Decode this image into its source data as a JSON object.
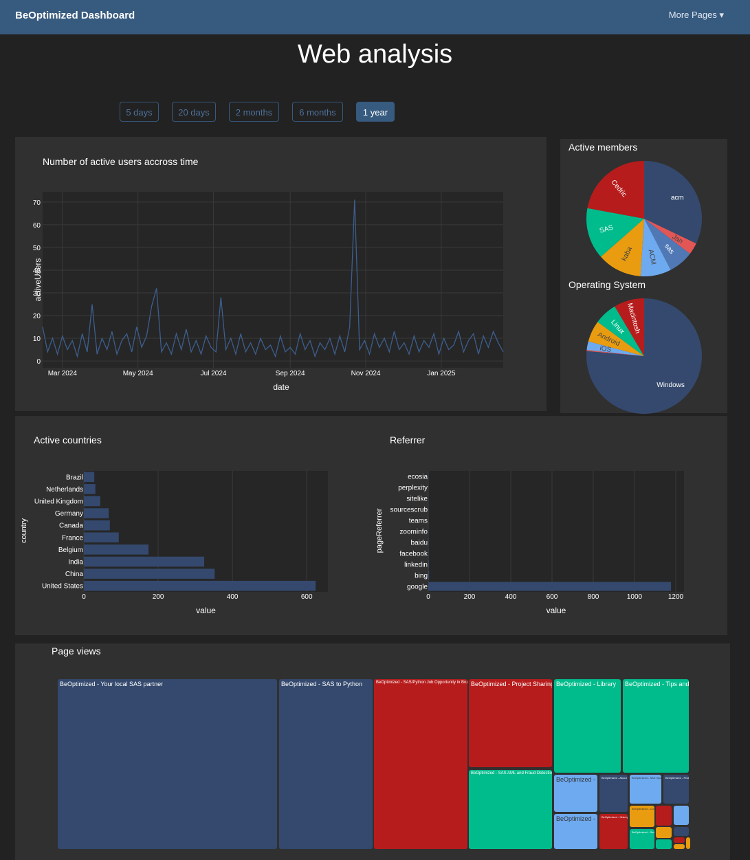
{
  "nav": {
    "brand": "BeOptimized Dashboard",
    "more": "More Pages ▾"
  },
  "title": "Web analysis",
  "ranges": [
    {
      "label": "5 days",
      "active": false
    },
    {
      "label": "20 days",
      "active": false
    },
    {
      "label": "2 months",
      "active": false
    },
    {
      "label": "6 months",
      "active": false
    },
    {
      "label": "1 year",
      "active": true
    }
  ],
  "colors": {
    "navbar": "#375a7f",
    "blue": "#34496d",
    "red": "#b71c1c",
    "green": "#00bc8c",
    "lightblue": "#6eaaf0",
    "orange": "#e99c0f",
    "pink": "#e35656",
    "steel": "#5078b4"
  },
  "chart_data": [
    {
      "type": "line",
      "title": "Number of active users accross time",
      "xlabel": "date",
      "ylabel": "activeUsers",
      "xlim": [
        "2024-02-14",
        "2025-02-20"
      ],
      "ylim": [
        -3,
        74.5
      ],
      "xticks": [
        "Mar 2024",
        "May 2024",
        "Jul 2024",
        "Sep 2024",
        "Nov 2024",
        "Jan 2025"
      ],
      "yticks": [
        0,
        10,
        20,
        30,
        40,
        50,
        60,
        70
      ],
      "x": [
        "2024-02-14",
        "2024-02-18",
        "2024-02-22",
        "2024-02-26",
        "2024-03-01",
        "2024-03-05",
        "2024-03-09",
        "2024-03-13",
        "2024-03-17",
        "2024-03-21",
        "2024-03-25",
        "2024-03-29",
        "2024-04-02",
        "2024-04-06",
        "2024-04-10",
        "2024-04-14",
        "2024-04-18",
        "2024-04-22",
        "2024-04-26",
        "2024-04-30",
        "2024-05-04",
        "2024-05-08",
        "2024-05-12",
        "2024-05-16",
        "2024-05-20",
        "2024-05-24",
        "2024-05-28",
        "2024-06-01",
        "2024-06-05",
        "2024-06-09",
        "2024-06-13",
        "2024-06-17",
        "2024-06-21",
        "2024-06-25",
        "2024-06-29",
        "2024-07-03",
        "2024-07-07",
        "2024-07-11",
        "2024-07-15",
        "2024-07-19",
        "2024-07-23",
        "2024-07-27",
        "2024-07-31",
        "2024-08-04",
        "2024-08-08",
        "2024-08-12",
        "2024-08-16",
        "2024-08-20",
        "2024-08-24",
        "2024-08-28",
        "2024-09-01",
        "2024-09-05",
        "2024-09-09",
        "2024-09-13",
        "2024-09-17",
        "2024-09-21",
        "2024-09-25",
        "2024-09-29",
        "2024-10-03",
        "2024-10-07",
        "2024-10-11",
        "2024-10-15",
        "2024-10-19",
        "2024-10-23",
        "2024-10-27",
        "2024-10-31",
        "2024-11-04",
        "2024-11-08",
        "2024-11-12",
        "2024-11-16",
        "2024-11-20",
        "2024-11-24",
        "2024-11-28",
        "2024-12-02",
        "2024-12-06",
        "2024-12-10",
        "2024-12-14",
        "2024-12-18",
        "2024-12-22",
        "2024-12-26",
        "2024-12-30",
        "2025-01-03",
        "2025-01-07",
        "2025-01-11",
        "2025-01-15",
        "2025-01-19",
        "2025-01-23",
        "2025-01-27",
        "2025-01-31",
        "2025-02-04",
        "2025-02-08",
        "2025-02-12",
        "2025-02-16",
        "2025-02-20"
      ],
      "y": [
        15,
        4,
        10,
        3,
        11,
        5,
        9,
        2,
        12,
        4,
        25,
        3,
        10,
        5,
        13,
        3,
        9,
        12,
        4,
        15,
        6,
        11,
        24,
        32,
        4,
        8,
        3,
        12,
        5,
        14,
        4,
        9,
        3,
        11,
        6,
        4,
        28,
        5,
        10,
        3,
        12,
        4,
        8,
        3,
        10,
        5,
        7,
        2,
        11,
        4,
        6,
        3,
        12,
        5,
        9,
        2,
        8,
        5,
        10,
        3,
        11,
        4,
        15,
        71,
        5,
        9,
        3,
        12,
        6,
        10,
        4,
        13,
        5,
        8,
        3,
        11,
        4,
        9,
        6,
        12,
        3,
        10,
        5,
        7,
        13,
        4,
        9,
        12,
        3,
        11,
        6,
        13,
        8,
        4
      ]
    },
    {
      "type": "pie",
      "title": "Active members",
      "labels": [
        "acm",
        "Jan",
        "sas",
        "ACM",
        "kaba",
        "SAS",
        "Cedric"
      ],
      "values": [
        32.1,
        3.3,
        7.0,
        8.6,
        12.5,
        14.4,
        22.1
      ]
    },
    {
      "type": "pie",
      "title": "Operating System",
      "labels": [
        "Windows",
        "",
        "iOS",
        "Android",
        "Linux",
        "Macintosh"
      ],
      "values": [
        76.4,
        0.3,
        2.4,
        6.0,
        6.4,
        8.5
      ]
    },
    {
      "type": "bar",
      "orientation": "h",
      "title": "Active countries",
      "xlabel": "value",
      "ylabel": "country",
      "xlim": [
        0,
        657
      ],
      "xticks": [
        0,
        200,
        400,
        600
      ],
      "categories": [
        "United States",
        "China",
        "India",
        "Belgium",
        "France",
        "Canada",
        "Germany",
        "United Kingdom",
        "Netherlands",
        "Brazil"
      ],
      "values": [
        624,
        352,
        324,
        174,
        94,
        70,
        67,
        44,
        31,
        28
      ]
    },
    {
      "type": "bar",
      "orientation": "h",
      "title": "Referrer",
      "xlabel": "value",
      "ylabel": "pageReferrer",
      "xlim": [
        0,
        1240
      ],
      "xticks": [
        0,
        200,
        400,
        600,
        800,
        1000,
        1200
      ],
      "categories": [
        "google",
        "bing",
        "linkedin",
        "facebook",
        "baidu",
        "zoominfo",
        "teams",
        "sourcescrub",
        "sitelike",
        "perplexity",
        "ecosia"
      ],
      "values": [
        1177,
        4,
        3,
        2,
        2,
        1,
        1,
        1,
        1,
        1,
        1
      ]
    }
  ],
  "treemap": {
    "title": "Page views",
    "tiles": [
      "BeOptimized - Your local SAS partner",
      "BeOptimized - SAS to Python",
      "BeOptimized - SAS/Python Job Opportunity in Brussels",
      "BeOptimized - Project Sharing",
      "BeOptimized - SAS AML and Fraud Detection",
      "BeOptimized - Library",
      "BeOptimized - Tips and Tricks",
      "BeOptimized - Login",
      "BeOptimized - Contact",
      "BeOptimized - About",
      "BeOptimized - History",
      "BeOptimized - SAS Viya",
      "BeOptimized - Pricing",
      "BeOptimized - Consulting",
      "BeOptimized - Security"
    ]
  }
}
